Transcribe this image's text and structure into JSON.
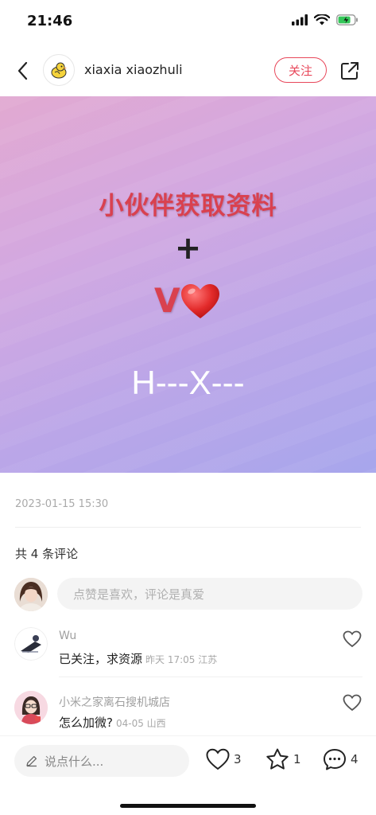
{
  "status_bar": {
    "time": "21:46"
  },
  "header": {
    "author_name": "xiaxia xiaozhuli",
    "follow_label": "关注"
  },
  "hero": {
    "line1": "小伙伴获取资料",
    "plus": "+",
    "v_text": "V",
    "code_text": "H---X---"
  },
  "post": {
    "timestamp": "2023-01-15 15:30",
    "comment_count_label": "共 4 条评论"
  },
  "comment_input": {
    "placeholder": "点赞是喜欢，评论是真爱"
  },
  "comments": [
    {
      "user": "Wu",
      "text": "已关注，求资源",
      "meta": "昨天 17:05 江苏"
    },
    {
      "user": "小米之家离石搜机城店",
      "text": "怎么加微?",
      "meta": "04-05 山西"
    }
  ],
  "bottom_bar": {
    "input_placeholder": "说点什么...",
    "likes": "3",
    "collects": "1",
    "comments": "4"
  },
  "colors": {
    "accent": "#e8475a",
    "hero_text_red": "#d9414f"
  },
  "icons": [
    "back-icon",
    "share-icon",
    "heart-icon",
    "star-icon",
    "comment-icon",
    "pencil-icon",
    "signal-icon",
    "wifi-icon",
    "battery-icon"
  ]
}
